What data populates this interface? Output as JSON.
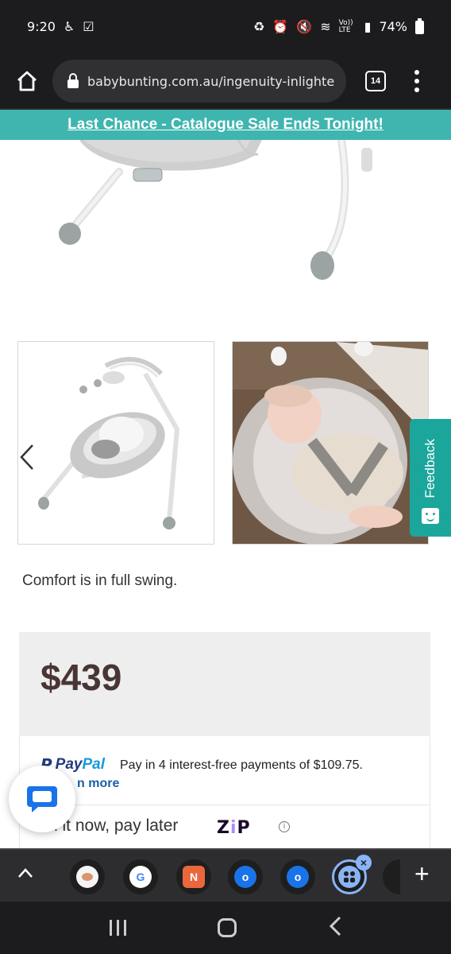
{
  "status_bar": {
    "time": "9:20",
    "battery": "74%",
    "lte": "Vo)) LTE"
  },
  "browser": {
    "url": "babybunting.com.au/ingenuity-inlighte",
    "tab_count": "14"
  },
  "promo": {
    "text": "Last Chance - Catalogue Sale Ends Tonight!"
  },
  "product": {
    "tagline": "Comfort is in full swing.",
    "price": "$439",
    "thumbnails": [
      {
        "icon": "swing-product-image"
      },
      {
        "icon": "baby-in-swing-image"
      }
    ]
  },
  "feedback": {
    "label": "Feedback"
  },
  "paypal": {
    "brand_pay": "Pay",
    "brand_pal": "Pal",
    "text": "Pay in 4 interest-free payments of $109.75.",
    "learn_more": "n more"
  },
  "zip": {
    "text": "n it now, pay later",
    "logo_z": "Z",
    "logo_i": "i",
    "logo_p": "P",
    "info": "i"
  },
  "taskbar": {
    "apps": [
      {
        "icon": "app-icon-1",
        "color": "#f5f5f5"
      },
      {
        "icon": "google-icon",
        "label": "G",
        "color": "#ffffff"
      },
      {
        "icon": "notion-icon",
        "label": "N",
        "color": "#e9673d"
      },
      {
        "icon": "outlook-icon",
        "label": "o",
        "color": "#1a73e8"
      },
      {
        "icon": "outlook-icon-2",
        "label": "o",
        "color": "#1a73e8"
      },
      {
        "icon": "apps-group-icon",
        "color": "#8ab4f8"
      }
    ]
  },
  "colors": {
    "teal": "#3fb5b0",
    "feedback": "#1ba69b",
    "price": "#4a3535"
  }
}
